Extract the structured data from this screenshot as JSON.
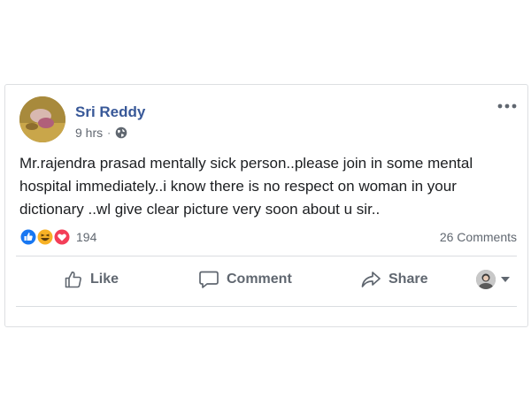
{
  "post": {
    "author": "Sri Reddy",
    "time": "9 hrs",
    "separator": "·",
    "privacy_icon": "globe-icon",
    "text": "Mr.rajendra prasad mentally sick person..please join in some mental hospital immediately..i know there is no respect on woman in your dictionary ..wl give clear picture very soon about u sir..",
    "reactions": {
      "icons": [
        "like-reaction-icon",
        "haha-reaction-icon",
        "love-reaction-icon"
      ],
      "count": "194"
    },
    "comments_count": "26 Comments"
  },
  "actions": {
    "like_label": "Like",
    "comment_label": "Comment",
    "share_label": "Share"
  },
  "colors": {
    "name": "#385898",
    "like_blue": "#1877f2",
    "haha_yellow": "#f7b125",
    "love_red": "#f33e58",
    "muted": "#606770"
  }
}
